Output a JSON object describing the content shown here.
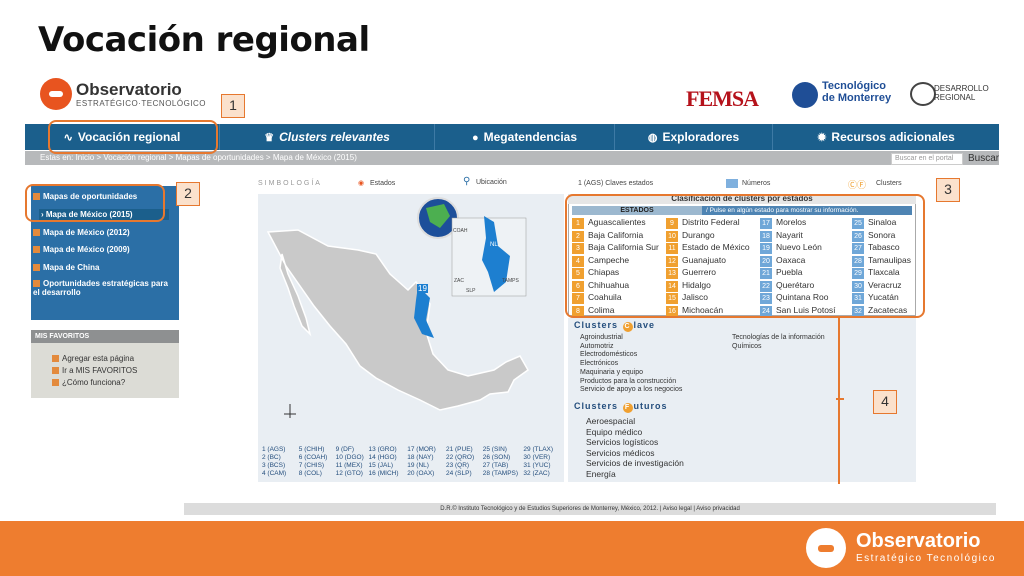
{
  "slide": {
    "title": "Vocación regional"
  },
  "header": {
    "logo_title": "Observatorio",
    "logo_sub": "ESTRATÉGICO·TECNOLÓGICO",
    "partner1": "FEMSA",
    "partner2": "Tecnológico\nde Monterrey",
    "partner3": "DESARROLLO\nREGIONAL"
  },
  "nav": {
    "items": [
      {
        "label": "Vocación regional",
        "icon": "vr-icon"
      },
      {
        "label": "Clusters relevantes",
        "icon": "crown-icon"
      },
      {
        "label": "Megatendencias",
        "icon": "bulb-icon"
      },
      {
        "label": "Exploradores",
        "icon": "globe-icon"
      },
      {
        "label": "Recursos adicionales",
        "icon": "gear-icon"
      }
    ],
    "breadcrumb": "Estas en: Inicio > Vocación regional > Mapas de oportunidades > Mapa de México (2015)",
    "search_placeholder": "Buscar en el portal",
    "search_button": "Buscar"
  },
  "sidebar": {
    "items": [
      "Mapas de oportunidades",
      "Mapa de México (2015)",
      "Mapa de México (2012)",
      "Mapa de México (2009)",
      "Mapa de China",
      "Oportunidades estratégicas para el desarrollo"
    ],
    "favorites_title": "MIS FAVORITOS",
    "favorites": [
      "Agregar esta página",
      "Ir a MIS FAVORITOS",
      "¿Cómo funciona?"
    ]
  },
  "legend": {
    "simbologia": "SIMBOLOGÍA",
    "estados": "Estados",
    "ubicacion": "Ubicación",
    "claves": "1 (AGS) Claves estados",
    "numeros": "Números",
    "clusters": "Clusters"
  },
  "map": {
    "state_label_nl": "NL",
    "state_label_coah": "COAH",
    "state_label_tamps": "TAMPS",
    "state_label_zac": "ZAC",
    "state_label_slp": "SLP",
    "highlight_num": "19",
    "codes": [
      [
        "1 (AGS)",
        "5 (CHIH)",
        "9 (DF)",
        "13 (GRO)",
        "17 (MOR)",
        "21 (PUE)",
        "25 (SIN)",
        "29 (TLAX)"
      ],
      [
        "2 (BC)",
        "6 (COAH)",
        "10 (DGO)",
        "14 (HGO)",
        "18 (NAY)",
        "22 (QRO)",
        "26 (SON)",
        "30 (VER)"
      ],
      [
        "3 (BCS)",
        "7 (CHIS)",
        "11 (MEX)",
        "15 (JAL)",
        "19 (NL)",
        "23 (QR)",
        "27 (TAB)",
        "31 (YUC)"
      ],
      [
        "4 (CAM)",
        "8 (COL)",
        "12 (GTO)",
        "16 (MICH)",
        "20 (OAX)",
        "24 (SLP)",
        "28 (TAMPS)",
        "32 (ZAC)"
      ]
    ]
  },
  "clusters": {
    "title": "Clasificación de clusters por estados",
    "estados_head": "ESTADOS",
    "note": "/ Pulse en algún estado para mostrar su información.",
    "states": [
      [
        "1",
        "Aguascalientes"
      ],
      [
        "2",
        "Baja California"
      ],
      [
        "3",
        "Baja California Sur"
      ],
      [
        "4",
        "Campeche"
      ],
      [
        "5",
        "Chiapas"
      ],
      [
        "6",
        "Chihuahua"
      ],
      [
        "7",
        "Coahuila"
      ],
      [
        "8",
        "Colima"
      ],
      [
        "9",
        "Distrito Federal"
      ],
      [
        "10",
        "Durango"
      ],
      [
        "11",
        "Estado de México"
      ],
      [
        "12",
        "Guanajuato"
      ],
      [
        "13",
        "Guerrero"
      ],
      [
        "14",
        "Hidalgo"
      ],
      [
        "15",
        "Jalisco"
      ],
      [
        "16",
        "Michoacán"
      ],
      [
        "17",
        "Morelos"
      ],
      [
        "18",
        "Nayarit"
      ],
      [
        "19",
        "Nuevo León"
      ],
      [
        "20",
        "Oaxaca"
      ],
      [
        "21",
        "Puebla"
      ],
      [
        "22",
        "Querétaro"
      ],
      [
        "23",
        "Quintana Roo"
      ],
      [
        "24",
        "San Luis Potosí"
      ],
      [
        "25",
        "Sinaloa"
      ],
      [
        "26",
        "Sonora"
      ],
      [
        "27",
        "Tabasco"
      ],
      [
        "28",
        "Tamaulipas"
      ],
      [
        "29",
        "Tlaxcala"
      ],
      [
        "30",
        "Veracruz"
      ],
      [
        "31",
        "Yucatán"
      ],
      [
        "32",
        "Zacatecas"
      ]
    ]
  },
  "clave": {
    "title_a": "Clusters",
    "title_o": "C",
    "title_b": "lave",
    "left": [
      "Agroindustrial",
      "Automotriz",
      "Electrodomésticos",
      "Electrónicos",
      "Maquinaria y equipo",
      "Productos para la construcción",
      "Servicio de apoyo a los negocios"
    ],
    "right": [
      "Tecnologías de la información",
      "Químicos"
    ]
  },
  "futuros": {
    "title_a": "Clusters",
    "title_o": "F",
    "title_b": "uturos",
    "items": [
      "Aeroespacial",
      "Equipo médico",
      "Servicios logísticos",
      "Servicios médicos",
      "Servicios de investigación",
      "Energía"
    ]
  },
  "footer": {
    "text": "D.R.© Instituto Tecnológico y de Estudios Superiores de Monterrey, México, 2012. | Aviso legal | Aviso privacidad",
    "brand_title": "Observatorio",
    "brand_sub": "Estratégico Tecnológico"
  },
  "callouts": [
    "1",
    "2",
    "3",
    "4"
  ],
  "colors": {
    "orange": "#ee7d2f",
    "nav_blue": "#1b5f8c",
    "highlight": "#1d7fd0"
  }
}
